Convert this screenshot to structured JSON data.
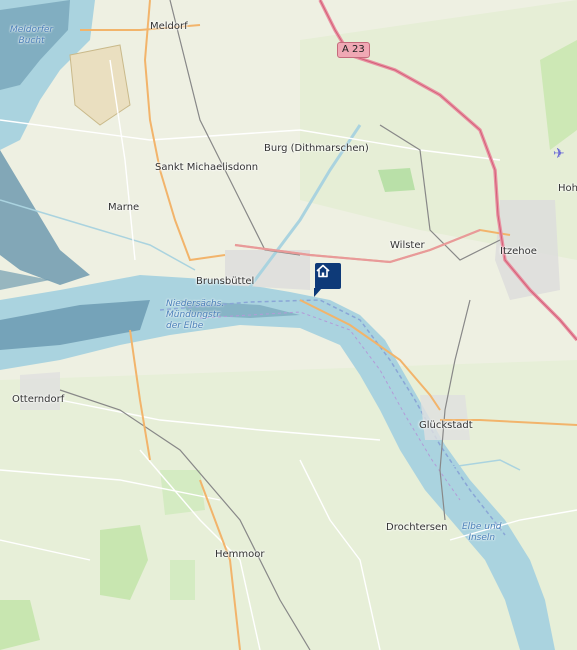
{
  "map": {
    "places": {
      "meldorf": "Meldorf",
      "burg": "Burg (Dithmarschen)",
      "sankt_michaelisdonn": "Sankt Michaelisdonn",
      "marne": "Marne",
      "wilster": "Wilster",
      "itzehoe": "Itzehoe",
      "hoh": "Hoh",
      "brunsbuettel": "Brunsbüttel",
      "otterndorf": "Otterndorf",
      "glueckstadt": "Glückstadt",
      "drochtersen": "Drochtersen",
      "hemmoor": "Hemmoor"
    },
    "water": {
      "meldorfer_bucht": "Meldorfer\nBucht",
      "elbe_mouth": "Niedersächs.\nMündungstr\nder Elbe",
      "elbe_inseln": "Elbe und\nInseln"
    },
    "road_shield": "A 23",
    "marker_icon": "home-icon",
    "airport_icon": "airplane-icon",
    "colors": {
      "land": "#f2efe9",
      "water": "#aad3df",
      "wetland": "#5e8fa8",
      "motorway": "#e892a2",
      "primary": "#fcd6a4",
      "marker": "#0e3a78"
    }
  }
}
